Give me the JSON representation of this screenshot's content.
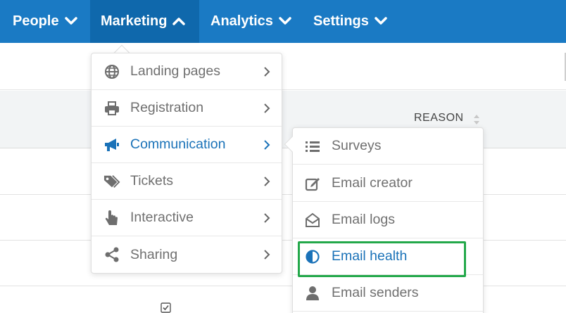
{
  "nav": {
    "items": [
      {
        "label": "People",
        "icon": "chevron-down-icon"
      },
      {
        "label": "Marketing",
        "icon": "chevron-up-icon",
        "active": true
      },
      {
        "label": "Analytics",
        "icon": "chevron-down-icon"
      },
      {
        "label": "Settings",
        "icon": "chevron-down-icon"
      }
    ]
  },
  "table": {
    "columns": [
      {
        "label": "REASON"
      }
    ]
  },
  "marketing_menu": {
    "items": [
      {
        "label": "Landing pages",
        "icon": "globe-icon"
      },
      {
        "label": "Registration",
        "icon": "printer-icon"
      },
      {
        "label": "Communication",
        "icon": "megaphone-icon",
        "active": true
      },
      {
        "label": "Tickets",
        "icon": "tags-icon"
      },
      {
        "label": "Interactive",
        "icon": "pointer-hand-icon"
      },
      {
        "label": "Sharing",
        "icon": "share-icon"
      }
    ]
  },
  "communication_menu": {
    "items": [
      {
        "label": "Surveys",
        "icon": "list-icon"
      },
      {
        "label": "Email creator",
        "icon": "edit-icon"
      },
      {
        "label": "Email logs",
        "icon": "open-envelope-icon"
      },
      {
        "label": "Email health",
        "icon": "half-circle-icon",
        "active": true,
        "highlighted": true
      },
      {
        "label": "Email senders",
        "icon": "user-icon"
      }
    ]
  },
  "colors": {
    "nav_bg": "#1a7ac4",
    "nav_active_bg": "#0f68ac",
    "accent": "#1a72b8",
    "highlight": "#23a84a",
    "menu_text": "#707070"
  }
}
